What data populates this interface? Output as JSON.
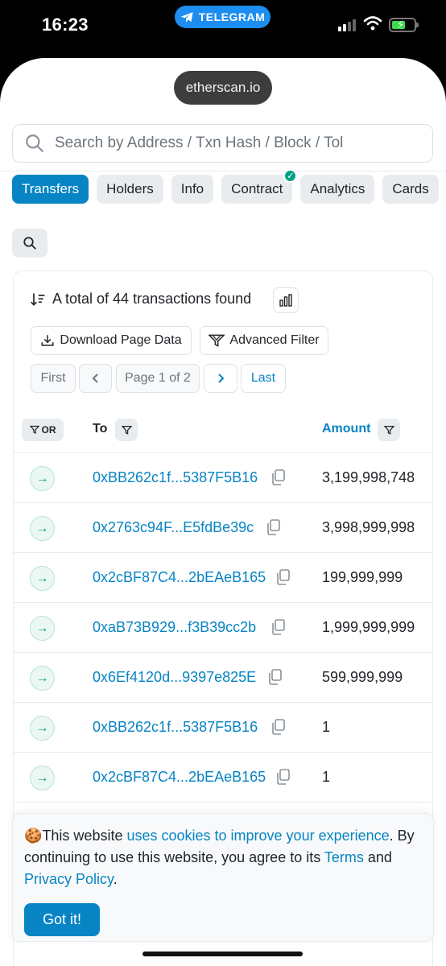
{
  "status": {
    "time": "16:23",
    "return_app": "TELEGRAM"
  },
  "browser": {
    "domain": "etherscan.io"
  },
  "search": {
    "placeholder": "Search by Address / Txn Hash / Block / Tol"
  },
  "tabs": [
    {
      "label": "Transfers",
      "active": true
    },
    {
      "label": "Holders"
    },
    {
      "label": "Info"
    },
    {
      "label": "Contract",
      "verified": true
    },
    {
      "label": "Analytics"
    },
    {
      "label": "Cards"
    }
  ],
  "summary": {
    "text": "A total of 44 transactions found"
  },
  "actions": {
    "download": "Download Page Data",
    "filter": "Advanced Filter"
  },
  "pagination": {
    "first": "First",
    "prev": "<",
    "page": "Page 1 of 2",
    "next": ">",
    "last": "Last"
  },
  "table": {
    "or_label": "OR",
    "col_to": "To",
    "col_amount": "Amount",
    "rows": [
      {
        "to": "0xBB262c1f...5387F5B16",
        "amount": "3,199,998,748"
      },
      {
        "to": "0x2763c94F...E5fdBe39c",
        "amount": "3,998,999,998"
      },
      {
        "to": "0x2cBF87C4...2bEAeB165",
        "amount": "199,999,999"
      },
      {
        "to": "0xaB73B929...f3B39cc2b",
        "amount": "1,999,999,999"
      },
      {
        "to": "0x6Ef4120d...9397e825E",
        "amount": "599,999,999"
      },
      {
        "to": "0xBB262c1f...5387F5B16",
        "amount": "1"
      },
      {
        "to": "0x2cBF87C4...2bEAeB165",
        "amount": "1"
      }
    ]
  },
  "cookie": {
    "text1": "This website ",
    "link1": "uses cookies to improve your experience",
    "text2": ". By continuing to use this website, you agree to its ",
    "link2": "Terms",
    "text3": " and ",
    "link3": "Privacy Policy",
    "text4": ".",
    "button": "Got it!"
  },
  "colors": {
    "accent": "#0784c3",
    "success": "#00a186",
    "telegram": "#1d8df0"
  },
  "icons": [
    "telegram-icon",
    "search-icon",
    "sort-icon",
    "chart-icon",
    "download-icon",
    "filter-icon",
    "arrow-right-icon",
    "copy-icon",
    "cookie-icon",
    "check-icon"
  ]
}
